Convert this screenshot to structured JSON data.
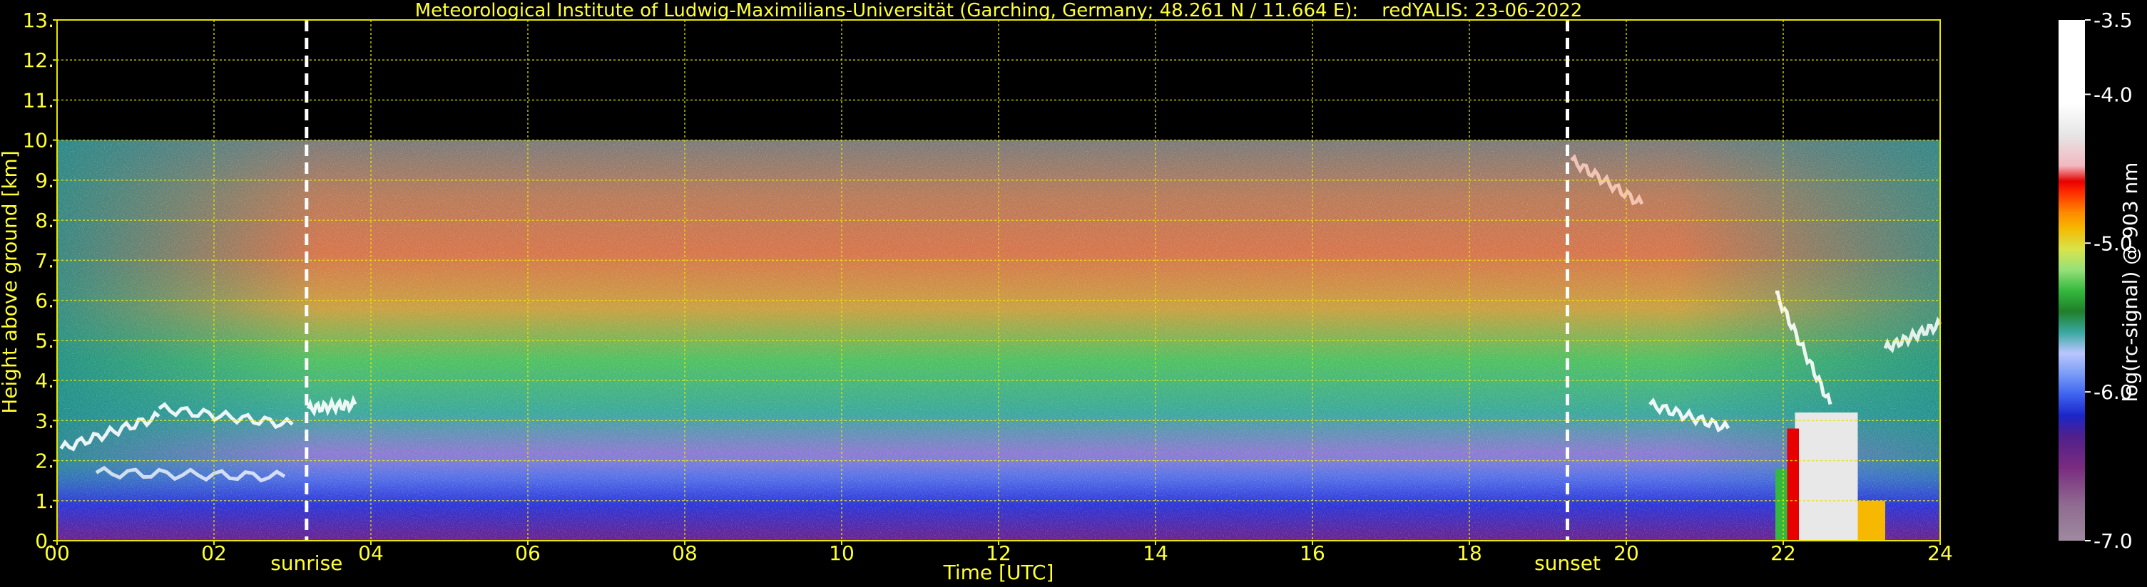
{
  "chart_data": {
    "type": "heatmap",
    "title": "Meteorological Institute of Ludwig-Maximilians-Universität (Garching, Germany; 48.261 N / 11.664 E):    redYALIS: 23-06-2022",
    "xlabel": "Time [UTC]",
    "ylabel": "Height above ground [km]",
    "xlim": [
      0,
      24
    ],
    "ylim": [
      0,
      13
    ],
    "x_ticks": [
      "00",
      "02",
      "04",
      "06",
      "08",
      "10",
      "12",
      "14",
      "16",
      "18",
      "20",
      "22",
      "24"
    ],
    "y_ticks": [
      "0.",
      "1.",
      "2.",
      "3.",
      "4.",
      "5.",
      "6.",
      "7.",
      "8.",
      "9.",
      "10.",
      "11.",
      "12.",
      "13."
    ],
    "grid": true,
    "data_ceiling_km": 10,
    "events": [
      {
        "label": "sunrise",
        "time": 3.18
      },
      {
        "label": "sunset",
        "time": 19.25
      }
    ],
    "colorbar": {
      "label": "log(rc-signal) @ 903 nm",
      "range": [
        -7.0,
        -3.5
      ],
      "ticks": [
        "-3.5",
        "-4.0",
        "-5.0",
        "-6.0",
        "-7.0"
      ]
    },
    "colors": {
      "background": "#000000",
      "text": "#ffff33",
      "grid": "#e6e600",
      "colorbar_text": "#ffffff"
    }
  }
}
